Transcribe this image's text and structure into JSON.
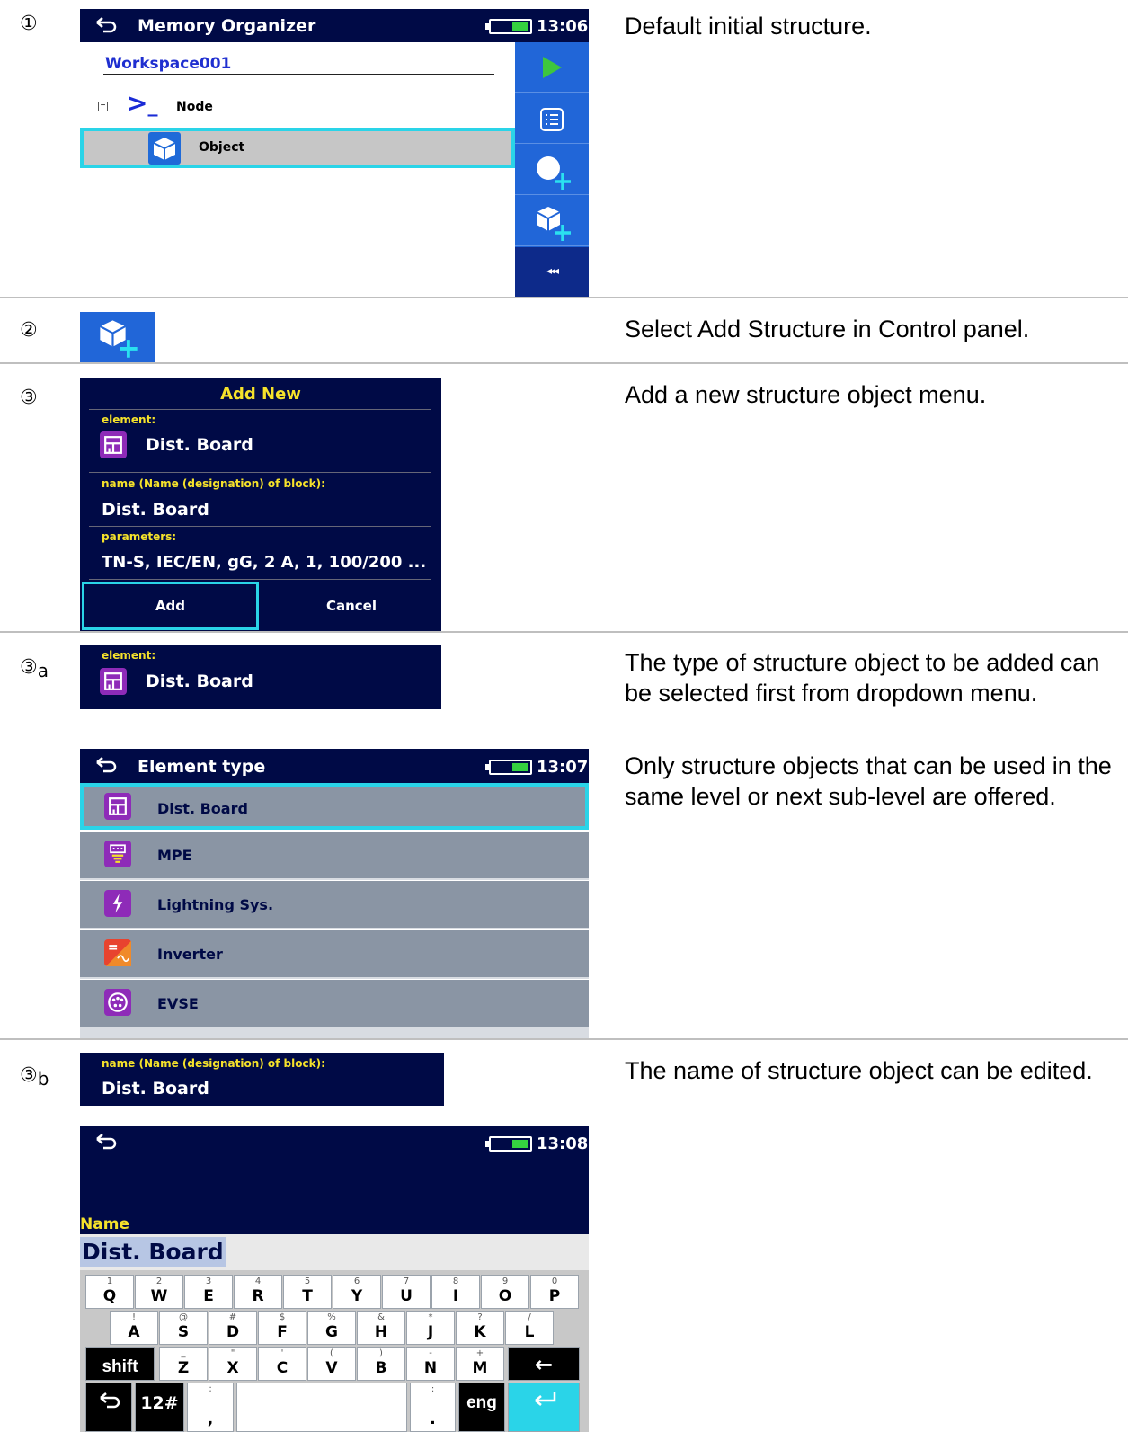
{
  "steps": {
    "s1": "①",
    "s2": "②",
    "s3": "③",
    "s3a_main": "③",
    "s3a_sub": "a",
    "s3b_main": "③",
    "s3b_sub": "b"
  },
  "descriptions": {
    "d1": "Default initial structure.",
    "d2": "Select Add Structure in Control panel.",
    "d3": "Add a new structure object menu.",
    "d3a": "The type of structure object to be added can be selected first from dropdown menu.",
    "d3a2": "Only structure objects that can be used in the same level or next sub-level are offered.",
    "d3b": "The name of structure object can be edited."
  },
  "memory_organizer": {
    "title": "Memory Organizer",
    "time": "13:06",
    "workspace": "Workspace001",
    "tree": [
      {
        "label": "Node",
        "collapse": "−"
      },
      {
        "label": "Object"
      }
    ],
    "panel_more": "◂◂◂"
  },
  "add_new": {
    "title": "Add New",
    "element_label": "element:",
    "element_value": "Dist. Board",
    "name_label": "name (Name (designation) of block):",
    "name_value": "Dist. Board",
    "params_label": "parameters:",
    "params_value": "TN-S, IEC/EN, gG, 2 A, 1, 100/200 ...",
    "add": "Add",
    "cancel": "Cancel"
  },
  "element_field": {
    "label": "element:",
    "value": "Dist. Board"
  },
  "element_type": {
    "title": "Element type",
    "time": "13:07",
    "items": [
      "Dist. Board",
      "MPE",
      "Lightning Sys.",
      "Inverter",
      "EVSE"
    ]
  },
  "name_field": {
    "label": "name (Name (designation) of block):",
    "value": "Dist. Board"
  },
  "keyboard_screen": {
    "time": "13:08",
    "field_label": "Name",
    "field_value": "Dist. Board",
    "row1": [
      [
        "1",
        "Q"
      ],
      [
        "2",
        "W"
      ],
      [
        "3",
        "E"
      ],
      [
        "4",
        "R"
      ],
      [
        "5",
        "T"
      ],
      [
        "6",
        "Y"
      ],
      [
        "7",
        "U"
      ],
      [
        "8",
        "I"
      ],
      [
        "9",
        "O"
      ],
      [
        "0",
        "P"
      ]
    ],
    "row2": [
      [
        "!",
        "A"
      ],
      [
        "@",
        "S"
      ],
      [
        "#",
        "D"
      ],
      [
        "$",
        "F"
      ],
      [
        "%",
        "G"
      ],
      [
        "&",
        "H"
      ],
      [
        "*",
        "J"
      ],
      [
        "?",
        "K"
      ],
      [
        "/",
        "L"
      ]
    ],
    "row3": [
      [
        "_",
        "Z"
      ],
      [
        "\"",
        "X"
      ],
      [
        "'",
        "C"
      ],
      [
        "(",
        "V"
      ],
      [
        ")",
        "B"
      ],
      [
        "-",
        "N"
      ],
      [
        "+",
        "M"
      ]
    ],
    "shift": "shift",
    "numsym": "12#",
    "comma_sup": ";",
    "comma": ",",
    "period_sup": ":",
    "period": ".",
    "lang": "eng"
  },
  "colors": {
    "navy": "#000a46",
    "accent_blue": "#2166d8",
    "cyan": "#2ad4e8",
    "yellow_label": "#f5e22b",
    "purple_icon": "#8e2bb8"
  }
}
